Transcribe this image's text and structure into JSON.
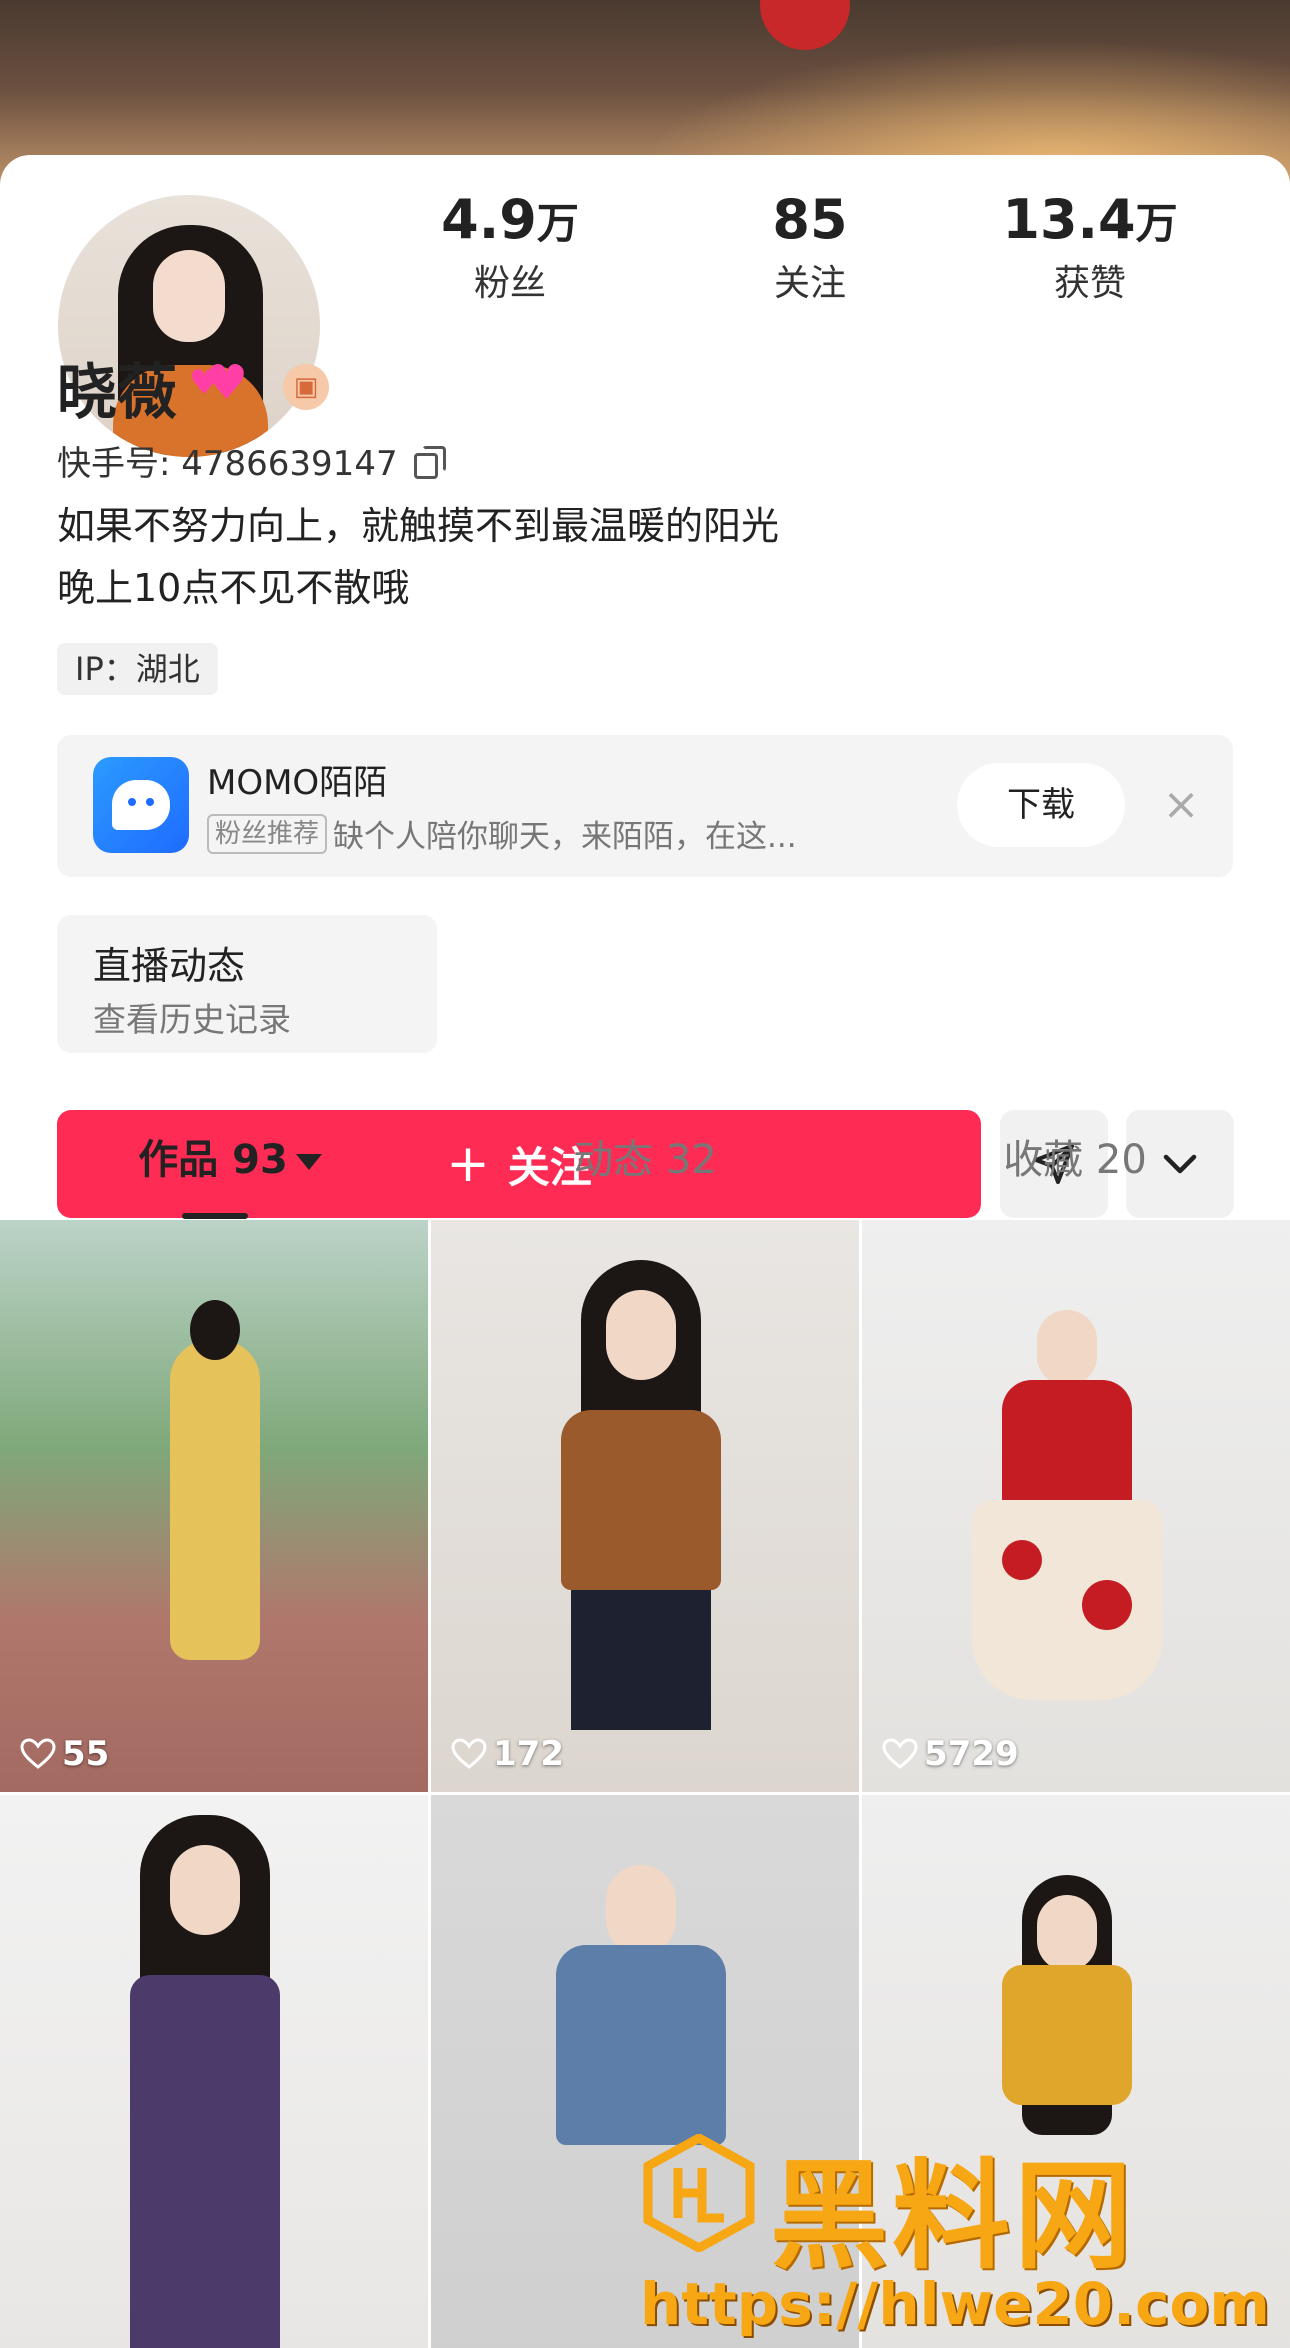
{
  "profile": {
    "name": "晓薇",
    "kuaishou_id_label": "快手号: 4786639147",
    "bio_line1": "如果不努力向上，就触摸不到最温暖的阳光",
    "bio_line2": "晚上10点不见不散哦",
    "ip_label": "IP：湖北"
  },
  "stats": [
    {
      "value": "4.9",
      "unit": "万",
      "label": "粉丝"
    },
    {
      "value": "85",
      "unit": "",
      "label": "关注"
    },
    {
      "value": "13.4",
      "unit": "万",
      "label": "获赞"
    }
  ],
  "ad": {
    "title": "MOMO陌陌",
    "tag": "粉丝推荐",
    "description": "缺个人陪你聊天，来陌陌，在这...",
    "button": "下载",
    "close": "×"
  },
  "live_card": {
    "title": "直播动态",
    "subtitle": "查看历史记录"
  },
  "actions": {
    "follow_label": "关注",
    "follow_plus": "+"
  },
  "tabs": [
    {
      "label": "作品 93",
      "active": true
    },
    {
      "label": "动态 32",
      "active": false
    },
    {
      "label": "收藏 20",
      "active": false
    }
  ],
  "videos": [
    {
      "likes": "55"
    },
    {
      "likes": "172"
    },
    {
      "likes": "5729"
    },
    {
      "likes": ""
    },
    {
      "likes": ""
    },
    {
      "likes": ""
    }
  ],
  "watermark": {
    "brand": "黑料网",
    "url": "https://hlwe20.com"
  },
  "colors": {
    "accent": "#fe2c55",
    "watermark": "#f7a614"
  },
  "icons": [
    "copy-icon",
    "heart-emoji",
    "level-badge",
    "momo-logo",
    "close-icon",
    "plus-icon",
    "share-icon",
    "chevron-down-icon",
    "caret-down-icon",
    "heart-icon"
  ]
}
